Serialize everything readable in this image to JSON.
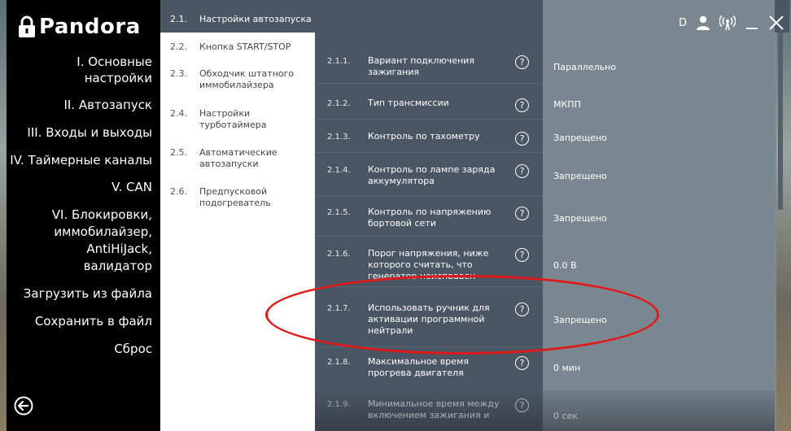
{
  "brand": {
    "name": "Pandora"
  },
  "menu": {
    "items": [
      {
        "label": "I. Основные настройки"
      },
      {
        "label": "II. Автозапуск"
      },
      {
        "label": "III. Входы и выходы"
      },
      {
        "label": "IV. Таймерные каналы"
      },
      {
        "label": "V. CAN"
      },
      {
        "label": "VI. Блокировки, иммобилайзер, AntiHiJack, валидатор"
      },
      {
        "label": "Загрузить из файла"
      },
      {
        "label": "Сохранить в файл"
      },
      {
        "label": "Сброс"
      }
    ]
  },
  "submenu": {
    "active": {
      "num": "2.1.",
      "label": "Настройки автозапуска"
    },
    "items": [
      {
        "num": "2.2.",
        "label": "Кнопка START/STOP"
      },
      {
        "num": "2.3.",
        "label": "Обходчик штатного иммобилайзера"
      },
      {
        "num": "2.4.",
        "label": "Настройки турботаймера"
      },
      {
        "num": "2.5.",
        "label": "Автоматические автозапуски"
      },
      {
        "num": "2.6.",
        "label": "Предпусковой подогреватель"
      }
    ]
  },
  "window": {
    "profile_letter": "D"
  },
  "params": [
    {
      "num": "2.1.1.",
      "name": "Вариант подключения зажигания",
      "value": "Параллельно"
    },
    {
      "num": "2.1.2.",
      "name": "Тип трансмиссии",
      "value": "МКПП"
    },
    {
      "num": "2.1.3.",
      "name": "Контроль по тахометру",
      "value": "Запрещено"
    },
    {
      "num": "2.1.4.",
      "name": "Контроль по лампе заряда аккумулятора",
      "value": "Запрещено"
    },
    {
      "num": "2.1.5.",
      "name": "Контроль по напряжению бортовой сети",
      "value": "Запрещено"
    },
    {
      "num": "2.1.6.",
      "name": "Порог напряжения, ниже которого считать, что генератор неисправен",
      "value": "0.0 В"
    },
    {
      "num": "2.1.7.",
      "name": "Использовать ручник для активации программной нейтрали",
      "value": "Запрещено"
    },
    {
      "num": "2.1.8.",
      "name": "Максимальное время прогрева двигателя",
      "value": "0 мин"
    },
    {
      "num": "2.1.9.",
      "name": "Минимальное время между включением зажигания и",
      "value": "0 сек"
    }
  ],
  "help_glyph": "?",
  "colors": {
    "accent_dark": "#4a5663",
    "values_bg": "#7a8791",
    "highlight": "#e01818"
  }
}
